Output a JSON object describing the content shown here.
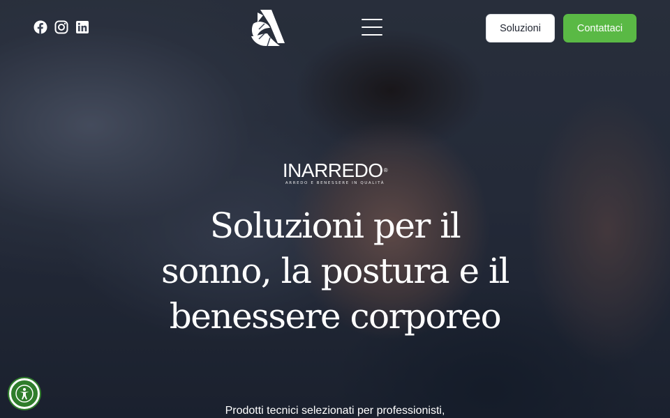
{
  "header": {
    "social": [
      {
        "icon": "facebook-icon"
      },
      {
        "icon": "instagram-icon"
      },
      {
        "icon": "linkedin-icon"
      }
    ],
    "brand_icon": "brand-mark-icon",
    "menu_icon": "hamburger-menu-icon",
    "solutions_label": "Soluzioni",
    "contact_label": "Contattaci"
  },
  "hero": {
    "logo": {
      "wordmark": "INARREDO",
      "registered": "®",
      "tagline": "ARREDO E BENESSERE IN QUALITÀ"
    },
    "headline": "Soluzioni per il sonno, la postura e il benessere corporeo",
    "subtext": "Prodotti tecnici selezionati per professionisti,"
  },
  "accessibility": {
    "icon": "accessibility-icon"
  },
  "colors": {
    "accent": "#5ab945",
    "accessibility": "#2f7d2b",
    "button_light": "#ffffff"
  }
}
